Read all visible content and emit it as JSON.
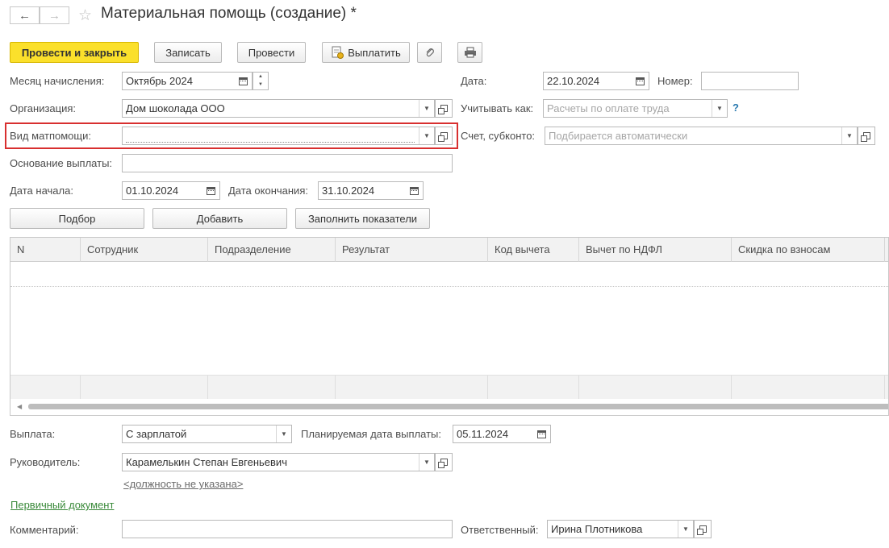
{
  "window": {
    "title": "Материальная помощь (создание) *"
  },
  "nav": {
    "back": "←",
    "forward": "→",
    "star": "☆"
  },
  "toolbar": {
    "post_close": "Провести и закрыть",
    "save": "Записать",
    "post": "Провести",
    "pay": "Выплатить"
  },
  "form": {
    "month_label": "Месяц начисления:",
    "month_value": "Октябрь 2024",
    "date_label": "Дата:",
    "date_value": "22.10.2024",
    "number_label": "Номер:",
    "number_value": "",
    "org_label": "Организация:",
    "org_value": "Дом шоколада ООО",
    "account_as_label": "Учитывать как:",
    "account_as_placeholder": "Расчеты по оплате труда",
    "help": "?",
    "aid_type_label": "Вид матпомощи:",
    "aid_type_value": "",
    "account_label": "Счет, субконто:",
    "account_placeholder": "Подбирается автоматически",
    "basis_label": "Основание выплаты:",
    "basis_value": "",
    "start_label": "Дата начала:",
    "start_value": "01.10.2024",
    "end_label": "Дата окончания:",
    "end_value": "31.10.2024"
  },
  "table_buttons": {
    "select": "Подбор",
    "add": "Добавить",
    "fill": "Заполнить показатели"
  },
  "table": {
    "columns": [
      "N",
      "Сотрудник",
      "Подразделение",
      "Результат",
      "Код вычета",
      "Вычет по НДФЛ",
      "Скидка по взносам"
    ]
  },
  "bottom": {
    "payout_label": "Выплата:",
    "payout_value": "С зарплатой",
    "planned_date_label": "Планируемая дата выплаты:",
    "planned_date_value": "05.11.2024",
    "manager_label": "Руководитель:",
    "manager_value": "Карамелькин Степан Евгеньевич",
    "position_link": "<должность не указана>",
    "primary_doc_link": "Первичный документ",
    "comment_label": "Комментарий:",
    "comment_value": "",
    "responsible_label": "Ответственный:",
    "responsible_value": "Ирина Плотникова"
  },
  "colors": {
    "accent_button": "#fbe02b",
    "highlight_frame": "#d82f2f",
    "link_green": "#3a8a3a",
    "link_gray": "#6b6b6b"
  }
}
